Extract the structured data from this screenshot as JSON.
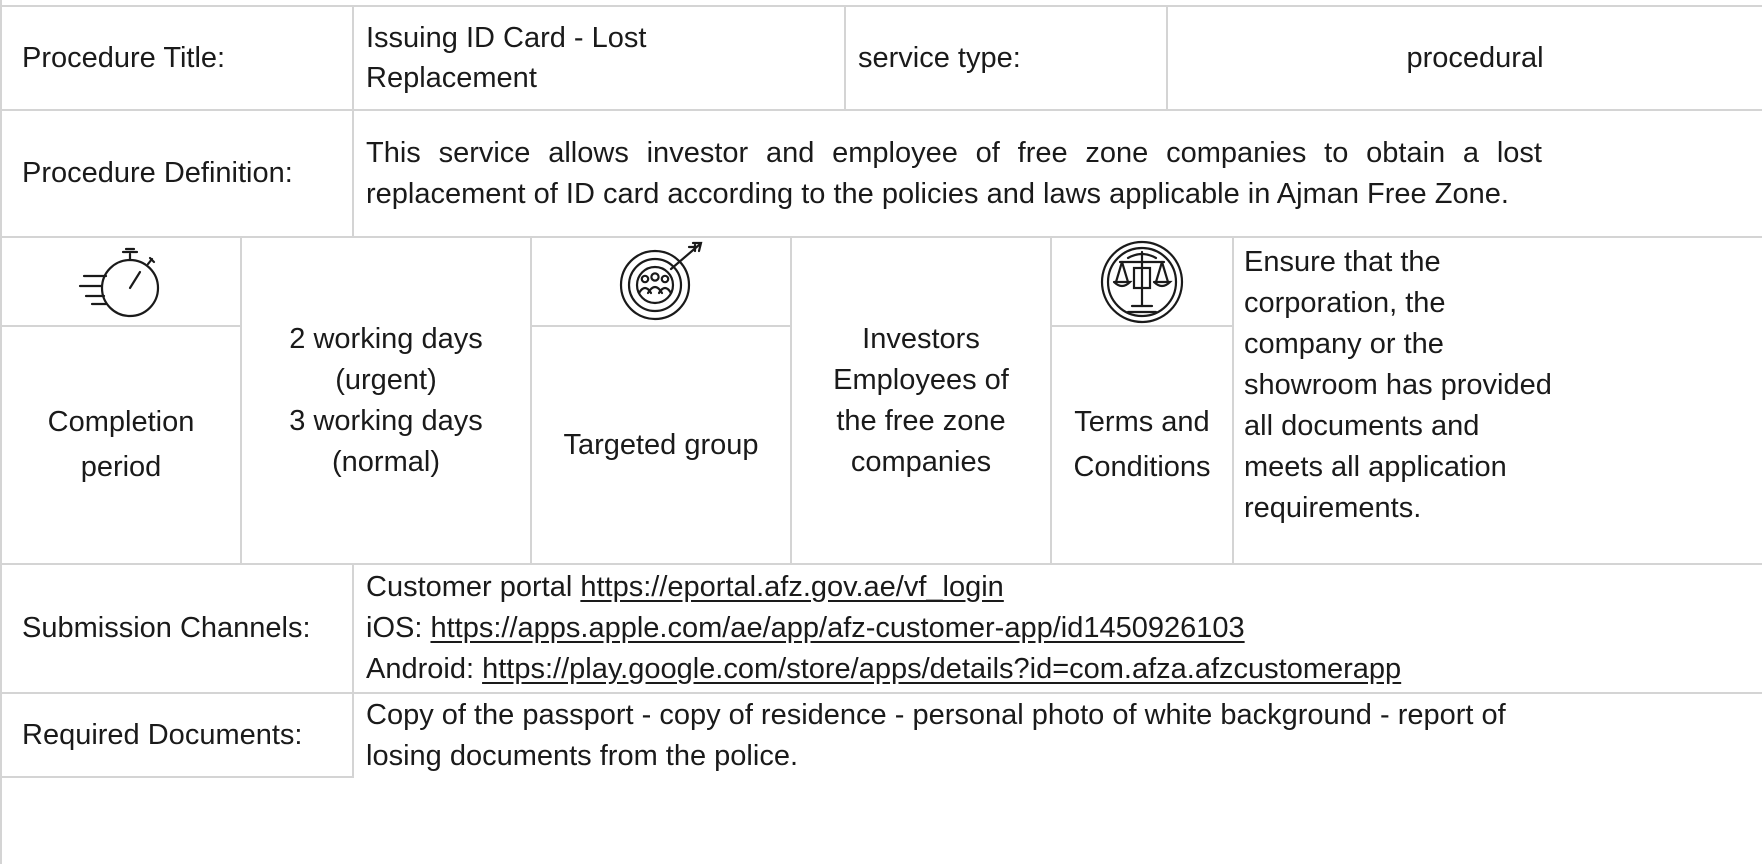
{
  "header": {
    "title_label": "Procedure Title:",
    "title_value": "Issuing ID Card - Lost Replacement",
    "service_type_label": "service type:",
    "service_type_value": "procedural"
  },
  "definition": {
    "label": "Procedure Definition:",
    "value": "This service allows investor and employee of free zone companies to obtain a lost replacement of ID card according to the policies and laws applicable in Ajman Free Zone."
  },
  "completion": {
    "icon": "stopwatch-icon",
    "label": "Completion period",
    "value_lines": [
      "2 working days",
      "(urgent)",
      "3 working days",
      "(normal)"
    ]
  },
  "targeted": {
    "icon": "target-group-icon",
    "label": "Targeted group",
    "value_lines": [
      "Investors",
      "Employees of",
      "the free zone",
      "companies"
    ]
  },
  "terms": {
    "icon": "scales-justice-icon",
    "label": "Terms and Conditions",
    "value": "Ensure that the corporation, the company or the showroom has provided all documents and meets all application requirements."
  },
  "submission": {
    "label": "Submission Channels:",
    "channels": [
      {
        "prefix": "Customer portal ",
        "url": "https://eportal.afz.gov.ae/vf_login"
      },
      {
        "prefix": "iOS: ",
        "url": "https://apps.apple.com/ae/app/afz-customer-app/id1450926103"
      },
      {
        "prefix": "Android: ",
        "url": "https://play.google.com/store/apps/details?id=com.afza.afzcustomerapp"
      }
    ]
  },
  "documents": {
    "label": "Required Documents:",
    "value": "Copy of the passport - copy of residence - personal photo of white background - report of losing documents from the police."
  },
  "colors": {
    "border": "#d4d4d4",
    "text": "#1a1a1a"
  }
}
